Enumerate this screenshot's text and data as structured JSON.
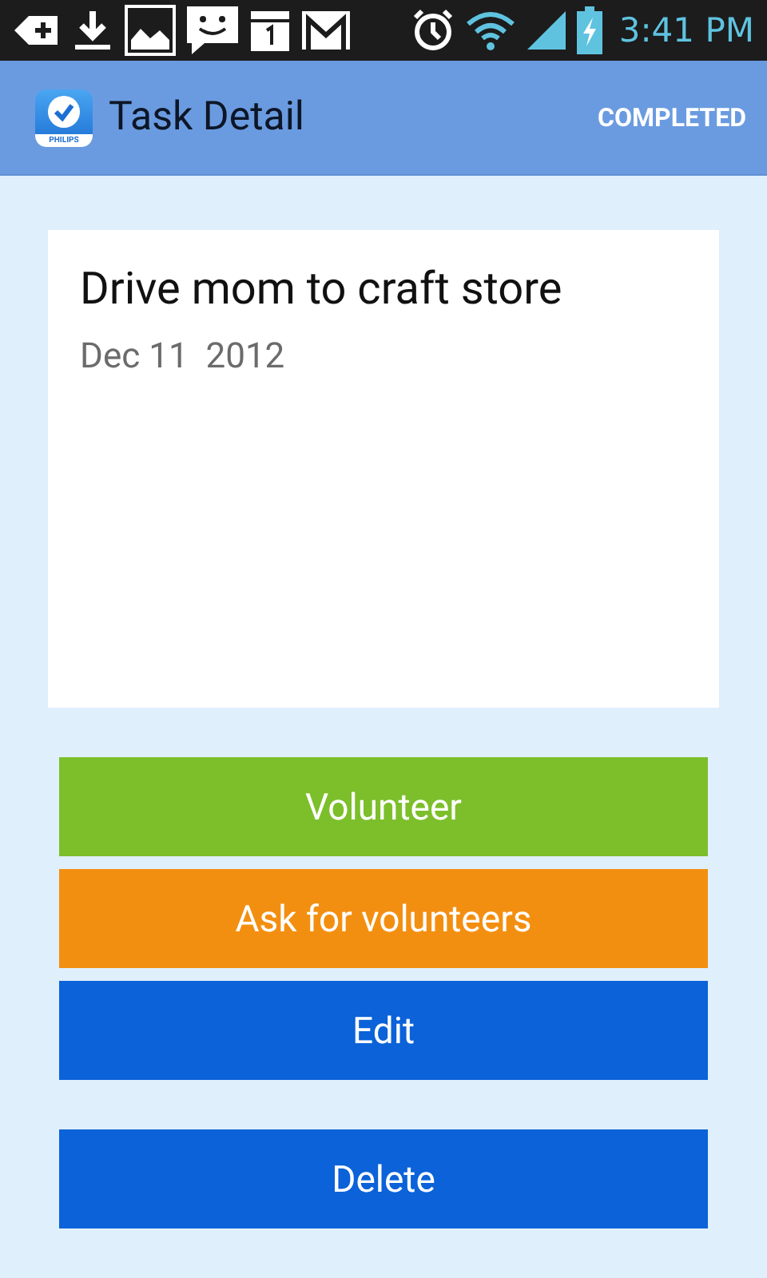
{
  "status_bar": {
    "time": "3:41 PM"
  },
  "action_bar": {
    "app_icon_label": "PHILIPS",
    "title": "Task Detail",
    "action": "COMPLETED"
  },
  "task": {
    "title": "Drive mom to craft store",
    "date": "Dec 11  2012"
  },
  "buttons": [
    {
      "label": "Volunteer",
      "color": "#7cbf2b"
    },
    {
      "label": "Ask for volunteers",
      "color": "#f38f10"
    },
    {
      "label": "Edit",
      "color": "#0b62d9"
    },
    {
      "label": "Delete",
      "color": "#0b62d9"
    }
  ]
}
